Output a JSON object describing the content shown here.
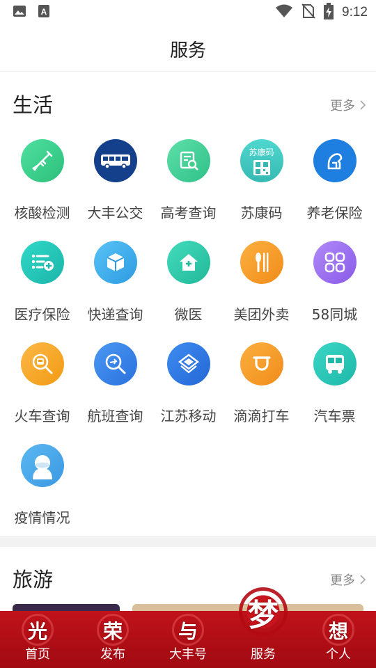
{
  "status": {
    "time": "9:12"
  },
  "header": {
    "title": "服务"
  },
  "life": {
    "title": "生活",
    "more": "更多",
    "items": [
      {
        "label": "核酸检测",
        "icon": "syringe-icon",
        "color": "#3fcf8a"
      },
      {
        "label": "大丰公交",
        "icon": "bus-icon",
        "color": "#1b4fa3"
      },
      {
        "label": "高考查询",
        "icon": "exam-search-icon",
        "color": "#3fcf8a"
      },
      {
        "label": "苏康码",
        "icon": "health-qr-icon",
        "color": "#40c9c2",
        "text": "苏康码"
      },
      {
        "label": "养老保险",
        "icon": "elder-insurance-icon",
        "color": "#1e88e5"
      },
      {
        "label": "医疗保险",
        "icon": "medical-insurance-icon",
        "color": "#22c6b9"
      },
      {
        "label": "快递查询",
        "icon": "package-icon",
        "color": "#3aa9e8"
      },
      {
        "label": "微医",
        "icon": "home-clinic-icon",
        "color": "#2fc7a4"
      },
      {
        "label": "美团外卖",
        "icon": "fork-knife-icon",
        "color": "#f59b25"
      },
      {
        "label": "58同城",
        "icon": "grid-apps-icon",
        "color": "#9a6cf0"
      },
      {
        "label": "火车查询",
        "icon": "train-search-icon",
        "color": "#f5a623"
      },
      {
        "label": "航班查询",
        "icon": "flight-search-icon",
        "color": "#2f7ee6"
      },
      {
        "label": "江苏移动",
        "icon": "china-mobile-icon",
        "color": "#2f7ee6"
      },
      {
        "label": "滴滴打车",
        "icon": "didi-icon",
        "color": "#f59b25"
      },
      {
        "label": "汽车票",
        "icon": "coach-icon",
        "color": "#26c6b8"
      },
      {
        "label": "疫情情况",
        "icon": "masked-person-icon",
        "color": "#3aa9e8"
      }
    ]
  },
  "travel": {
    "title": "旅游",
    "more": "更多"
  },
  "tabs": [
    {
      "label": "首页",
      "glyph": "光"
    },
    {
      "label": "发布",
      "glyph": "荣"
    },
    {
      "label": "大丰号",
      "glyph": "与"
    },
    {
      "label": "服务",
      "glyph": "梦"
    },
    {
      "label": "个人",
      "glyph": "想"
    }
  ]
}
